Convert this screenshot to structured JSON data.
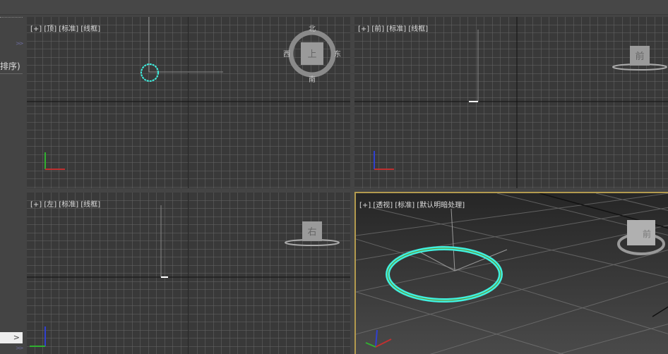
{
  "left_panel": {
    "sort_label": "排序)",
    "expand_symbol": ">",
    "chevron": ">>"
  },
  "viewports": [
    {
      "id": "top",
      "label": "[+] [顶] [标准] [线框]",
      "cube": {
        "face": "上",
        "n": "北",
        "s": "南",
        "e": "东",
        "w": "西"
      }
    },
    {
      "id": "front",
      "label": "[+] [前] [标准] [线框]",
      "cube": {
        "face": "前"
      }
    },
    {
      "id": "left",
      "label": "[+] [左] [标准] [线框]",
      "cube": {
        "face": "右"
      }
    },
    {
      "id": "perspective",
      "label": "[+] [透视] [标准] [默认明暗处理]",
      "cube": {
        "face": "前"
      }
    }
  ],
  "axes": {
    "x": "x",
    "y": "y",
    "z": "z"
  },
  "colors": {
    "selection": "#3ff0e0",
    "active_border": "#b39a4e",
    "grid": "#666666",
    "axis_x": "#c03030",
    "axis_y": "#30b030",
    "axis_z": "#3040d0"
  }
}
